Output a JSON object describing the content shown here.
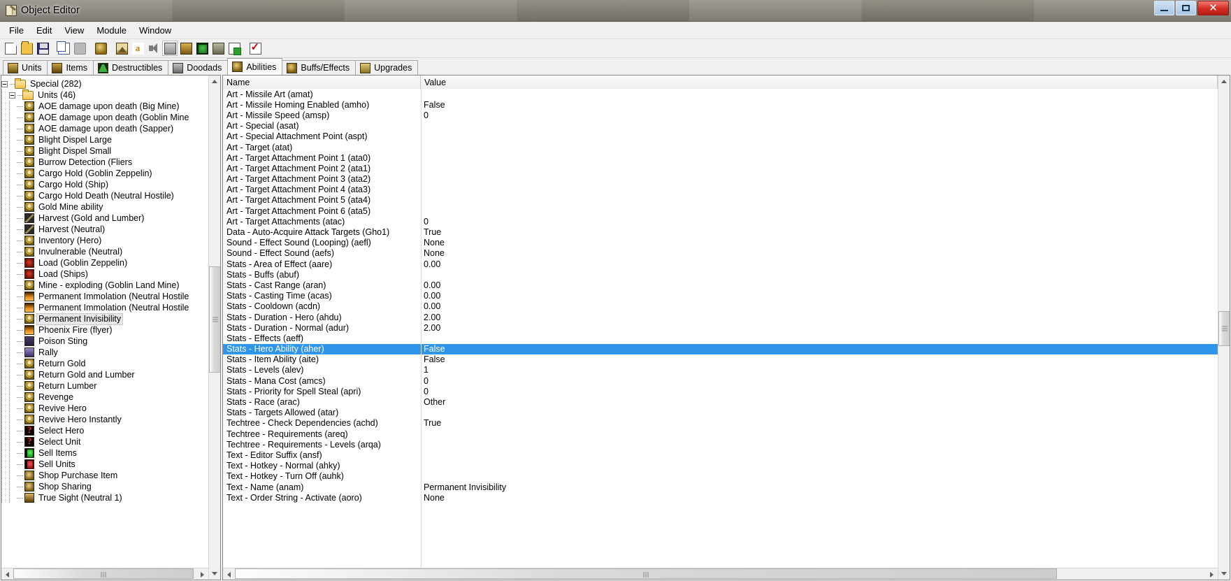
{
  "window": {
    "title": "Object Editor",
    "icon": "object-editor-icon",
    "caption_buttons": [
      {
        "name": "minimize",
        "glyph": "–"
      },
      {
        "name": "maximize",
        "glyph": "❐"
      },
      {
        "name": "close",
        "glyph": "✕"
      }
    ]
  },
  "menubar": {
    "items": [
      "File",
      "Edit",
      "View",
      "Module",
      "Window"
    ]
  },
  "toolbar": {
    "buttons": [
      {
        "name": "new-icon",
        "cls": "ico-new",
        "framed": false
      },
      {
        "name": "open-icon",
        "cls": "ico-open",
        "framed": false
      },
      {
        "name": "save-icon",
        "cls": "ico-save",
        "framed": false
      },
      {
        "name": "sep1",
        "cls": "sep",
        "framed": false
      },
      {
        "name": "copy-icon",
        "cls": "ico-copy",
        "framed": false
      },
      {
        "name": "paste-icon",
        "cls": "ico-paste",
        "framed": false
      },
      {
        "name": "sep2",
        "cls": "sep",
        "framed": false
      },
      {
        "name": "ability-fist-icon",
        "cls": "ico-fist",
        "framed": false
      },
      {
        "name": "sep3",
        "cls": "sep",
        "framed": false
      },
      {
        "name": "terrain-editor-icon",
        "cls": "ico-terrain",
        "framed": false
      },
      {
        "name": "trigger-editor-icon",
        "cls": "ico-a",
        "framed": false
      },
      {
        "name": "sound-editor-icon",
        "cls": "ico-sound",
        "framed": false
      },
      {
        "name": "object-editor-icon",
        "cls": "ico-tower",
        "framed": true
      },
      {
        "name": "campaign-editor-icon",
        "cls": "ico-item",
        "framed": false
      },
      {
        "name": "ai-editor-icon",
        "cls": "ico-unit",
        "framed": false
      },
      {
        "name": "object-manager-icon",
        "cls": "ico-dood",
        "framed": false
      },
      {
        "name": "import-manager-icon",
        "cls": "ico-upg",
        "framed": false
      },
      {
        "name": "sep4",
        "cls": "sep",
        "framed": false
      },
      {
        "name": "test-map-icon",
        "cls": "ico-check",
        "framed": false
      }
    ]
  },
  "tabs": [
    {
      "label": "Units",
      "icon": "units-tab-icon",
      "cls": "ti-units",
      "active": false
    },
    {
      "label": "Items",
      "icon": "items-tab-icon",
      "cls": "ti-items",
      "active": false
    },
    {
      "label": "Destructibles",
      "icon": "destructibles-tab-icon",
      "cls": "ti-destruct",
      "active": false
    },
    {
      "label": "Doodads",
      "icon": "doodads-tab-icon",
      "cls": "ti-doodads",
      "active": false
    },
    {
      "label": "Abilities",
      "icon": "abilities-tab-icon",
      "cls": "ti-abilities",
      "active": true
    },
    {
      "label": "Buffs/Effects",
      "icon": "buffs-effects-tab-icon",
      "cls": "ti-buffs",
      "active": false
    },
    {
      "label": "Upgrades",
      "icon": "upgrades-tab-icon",
      "cls": "ti-upgrades",
      "active": false
    }
  ],
  "tree": {
    "nodes": [
      {
        "label": "Special (282)",
        "depth": 0,
        "type": "folder",
        "icon": "folder-icon",
        "expanded": true,
        "selected": false
      },
      {
        "label": "Units (46)",
        "depth": 1,
        "type": "folder",
        "icon": "folder-icon",
        "expanded": true,
        "selected": false
      },
      {
        "label": "AOE damage upon death (Big Mine)",
        "depth": 2,
        "type": "leaf",
        "icon": "ability-skull-icon",
        "cls": "ti-skull",
        "selected": false
      },
      {
        "label": "AOE damage upon death (Goblin Mine",
        "depth": 2,
        "type": "leaf",
        "icon": "ability-skull-icon",
        "cls": "ti-skull",
        "selected": false
      },
      {
        "label": "AOE damage upon death (Sapper)",
        "depth": 2,
        "type": "leaf",
        "icon": "ability-skull-icon",
        "cls": "ti-skull",
        "selected": false
      },
      {
        "label": "Blight Dispel Large",
        "depth": 2,
        "type": "leaf",
        "icon": "ability-skull-icon",
        "cls": "ti-skull",
        "selected": false
      },
      {
        "label": "Blight Dispel Small",
        "depth": 2,
        "type": "leaf",
        "icon": "ability-skull-icon",
        "cls": "ti-skull",
        "selected": false
      },
      {
        "label": "Burrow Detection (Fliers",
        "depth": 2,
        "type": "leaf",
        "icon": "ability-skull-icon",
        "cls": "ti-skull",
        "selected": false
      },
      {
        "label": "Cargo Hold (Goblin Zeppelin)",
        "depth": 2,
        "type": "leaf",
        "icon": "ability-skull-icon",
        "cls": "ti-skull",
        "selected": false
      },
      {
        "label": "Cargo Hold (Ship)",
        "depth": 2,
        "type": "leaf",
        "icon": "ability-skull-icon",
        "cls": "ti-skull",
        "selected": false
      },
      {
        "label": "Cargo Hold Death (Neutral Hostile)",
        "depth": 2,
        "type": "leaf",
        "icon": "ability-skull-icon",
        "cls": "ti-skull",
        "selected": false
      },
      {
        "label": "Gold Mine ability",
        "depth": 2,
        "type": "leaf",
        "icon": "ability-skull-icon",
        "cls": "ti-skull",
        "selected": false
      },
      {
        "label": "Harvest (Gold and Lumber)",
        "depth": 2,
        "type": "leaf",
        "icon": "harvest-icon",
        "cls": "ti-harvest",
        "selected": false
      },
      {
        "label": "Harvest (Neutral)",
        "depth": 2,
        "type": "leaf",
        "icon": "harvest-icon",
        "cls": "ti-harvest",
        "selected": false
      },
      {
        "label": "Inventory (Hero)",
        "depth": 2,
        "type": "leaf",
        "icon": "ability-skull-icon",
        "cls": "ti-skull",
        "selected": false
      },
      {
        "label": "Invulnerable (Neutral)",
        "depth": 2,
        "type": "leaf",
        "icon": "ability-skull-icon",
        "cls": "ti-skull",
        "selected": false
      },
      {
        "label": "Load (Goblin Zeppelin)",
        "depth": 2,
        "type": "leaf",
        "icon": "load-icon",
        "cls": "ti-red",
        "selected": false
      },
      {
        "label": "Load (Ships)",
        "depth": 2,
        "type": "leaf",
        "icon": "load-icon",
        "cls": "ti-red",
        "selected": false
      },
      {
        "label": "Mine - exploding (Goblin Land Mine)",
        "depth": 2,
        "type": "leaf",
        "icon": "ability-skull-icon",
        "cls": "ti-skull",
        "selected": false
      },
      {
        "label": "Permanent Immolation (Neutral Hostile",
        "depth": 2,
        "type": "leaf",
        "icon": "immolation-icon",
        "cls": "ti-immol",
        "selected": false
      },
      {
        "label": "Permanent Immolation (Neutral Hostile",
        "depth": 2,
        "type": "leaf",
        "icon": "immolation-icon",
        "cls": "ti-immol",
        "selected": false
      },
      {
        "label": "Permanent Invisibility",
        "depth": 2,
        "type": "leaf",
        "icon": "ability-skull-icon",
        "cls": "ti-skull",
        "selected": true
      },
      {
        "label": "Phoenix Fire (flyer)",
        "depth": 2,
        "type": "leaf",
        "icon": "phoenix-fire-icon",
        "cls": "ti-immol",
        "selected": false
      },
      {
        "label": "Poison Sting",
        "depth": 2,
        "type": "leaf",
        "icon": "poison-sting-icon",
        "cls": "ti-poison",
        "selected": false
      },
      {
        "label": "Rally",
        "depth": 2,
        "type": "leaf",
        "icon": "rally-icon",
        "cls": "ti-rally",
        "selected": false
      },
      {
        "label": "Return Gold",
        "depth": 2,
        "type": "leaf",
        "icon": "ability-skull-icon",
        "cls": "ti-skull",
        "selected": false
      },
      {
        "label": "Return Gold and Lumber",
        "depth": 2,
        "type": "leaf",
        "icon": "ability-skull-icon",
        "cls": "ti-skull",
        "selected": false
      },
      {
        "label": "Return Lumber",
        "depth": 2,
        "type": "leaf",
        "icon": "ability-skull-icon",
        "cls": "ti-skull",
        "selected": false
      },
      {
        "label": "Revenge",
        "depth": 2,
        "type": "leaf",
        "icon": "ability-skull-icon",
        "cls": "ti-skull",
        "selected": false
      },
      {
        "label": "Revive Hero",
        "depth": 2,
        "type": "leaf",
        "icon": "ability-skull-icon",
        "cls": "ti-skull",
        "selected": false
      },
      {
        "label": "Revive Hero Instantly",
        "depth": 2,
        "type": "leaf",
        "icon": "ability-skull-icon",
        "cls": "ti-skull",
        "selected": false
      },
      {
        "label": "Select Hero",
        "depth": 2,
        "type": "leaf",
        "icon": "question-mark-icon",
        "cls": "ti-quest",
        "selected": false
      },
      {
        "label": "Select Unit",
        "depth": 2,
        "type": "leaf",
        "icon": "question-mark-icon",
        "cls": "ti-quest",
        "selected": false
      },
      {
        "label": "Sell Items",
        "depth": 2,
        "type": "leaf",
        "icon": "sell-items-icon",
        "cls": "ti-sellitems",
        "selected": false
      },
      {
        "label": "Sell Units",
        "depth": 2,
        "type": "leaf",
        "icon": "sell-units-icon",
        "cls": "ti-sellunits",
        "selected": false
      },
      {
        "label": "Shop Purchase Item",
        "depth": 2,
        "type": "leaf",
        "icon": "shop-icon",
        "cls": "ti-shop",
        "selected": false
      },
      {
        "label": "Shop Sharing",
        "depth": 2,
        "type": "leaf",
        "icon": "shop-icon",
        "cls": "ti-shop",
        "selected": false
      },
      {
        "label": "True Sight (Neutral 1)",
        "depth": 2,
        "type": "leaf",
        "icon": "true-sight-icon",
        "cls": "ti-truesight",
        "selected": false
      }
    ]
  },
  "list": {
    "columns": [
      "Name",
      "Value"
    ],
    "rows": [
      {
        "name": "Art - Missile Art (amat)",
        "value": "",
        "selected": false
      },
      {
        "name": "Art - Missile Homing Enabled (amho)",
        "value": "False",
        "selected": false
      },
      {
        "name": "Art - Missile Speed (amsp)",
        "value": "0",
        "selected": false
      },
      {
        "name": "Art - Special (asat)",
        "value": "",
        "selected": false
      },
      {
        "name": "Art - Special Attachment Point (aspt)",
        "value": "",
        "selected": false
      },
      {
        "name": "Art - Target (atat)",
        "value": "",
        "selected": false
      },
      {
        "name": "Art - Target Attachment Point 1 (ata0)",
        "value": "",
        "selected": false
      },
      {
        "name": "Art - Target Attachment Point 2 (ata1)",
        "value": "",
        "selected": false
      },
      {
        "name": "Art - Target Attachment Point 3 (ata2)",
        "value": "",
        "selected": false
      },
      {
        "name": "Art - Target Attachment Point 4 (ata3)",
        "value": "",
        "selected": false
      },
      {
        "name": "Art - Target Attachment Point 5 (ata4)",
        "value": "",
        "selected": false
      },
      {
        "name": "Art - Target Attachment Point 6 (ata5)",
        "value": "",
        "selected": false
      },
      {
        "name": "Art - Target Attachments (atac)",
        "value": "0",
        "selected": false
      },
      {
        "name": "Data - Auto-Acquire Attack Targets (Gho1)",
        "value": "True",
        "selected": false
      },
      {
        "name": "Sound - Effect Sound (Looping) (aefl)",
        "value": "None",
        "selected": false
      },
      {
        "name": "Sound - Effect Sound (aefs)",
        "value": "None",
        "selected": false
      },
      {
        "name": "Stats - Area of Effect (aare)",
        "value": "0.00",
        "selected": false
      },
      {
        "name": "Stats - Buffs (abuf)",
        "value": "",
        "selected": false
      },
      {
        "name": "Stats - Cast Range (aran)",
        "value": "0.00",
        "selected": false
      },
      {
        "name": "Stats - Casting Time (acas)",
        "value": "0.00",
        "selected": false
      },
      {
        "name": "Stats - Cooldown (acdn)",
        "value": "0.00",
        "selected": false
      },
      {
        "name": "Stats - Duration - Hero (ahdu)",
        "value": "2.00",
        "selected": false
      },
      {
        "name": "Stats - Duration - Normal (adur)",
        "value": "2.00",
        "selected": false
      },
      {
        "name": "Stats - Effects (aeff)",
        "value": "",
        "selected": false
      },
      {
        "name": "Stats - Hero Ability (aher)",
        "value": "False",
        "selected": true
      },
      {
        "name": "Stats - Item Ability (aite)",
        "value": "False",
        "selected": false
      },
      {
        "name": "Stats - Levels (alev)",
        "value": "1",
        "selected": false
      },
      {
        "name": "Stats - Mana Cost (amcs)",
        "value": "0",
        "selected": false
      },
      {
        "name": "Stats - Priority for Spell Steal (apri)",
        "value": "0",
        "selected": false
      },
      {
        "name": "Stats - Race (arac)",
        "value": "Other",
        "selected": false
      },
      {
        "name": "Stats - Targets Allowed (atar)",
        "value": "",
        "selected": false
      },
      {
        "name": "Techtree - Check Dependencies (achd)",
        "value": "True",
        "selected": false
      },
      {
        "name": "Techtree - Requirements (areq)",
        "value": "",
        "selected": false
      },
      {
        "name": "Techtree - Requirements - Levels (arqa)",
        "value": "",
        "selected": false
      },
      {
        "name": "Text - Editor Suffix (ansf)",
        "value": "",
        "selected": false
      },
      {
        "name": "Text - Hotkey - Normal (ahky)",
        "value": "",
        "selected": false
      },
      {
        "name": "Text - Hotkey - Turn Off (auhk)",
        "value": "",
        "selected": false
      },
      {
        "name": "Text - Name (anam)",
        "value": "Permanent Invisibility",
        "selected": false
      },
      {
        "name": "Text - Order String - Activate (aoro)",
        "value": "None",
        "selected": false
      }
    ]
  },
  "colors": {
    "selection_blue": "#2f95ea",
    "tree_selection_gray": "#e8e8e8",
    "window_bg": "#f0f0f0",
    "close_button_red": "#d22d22"
  }
}
